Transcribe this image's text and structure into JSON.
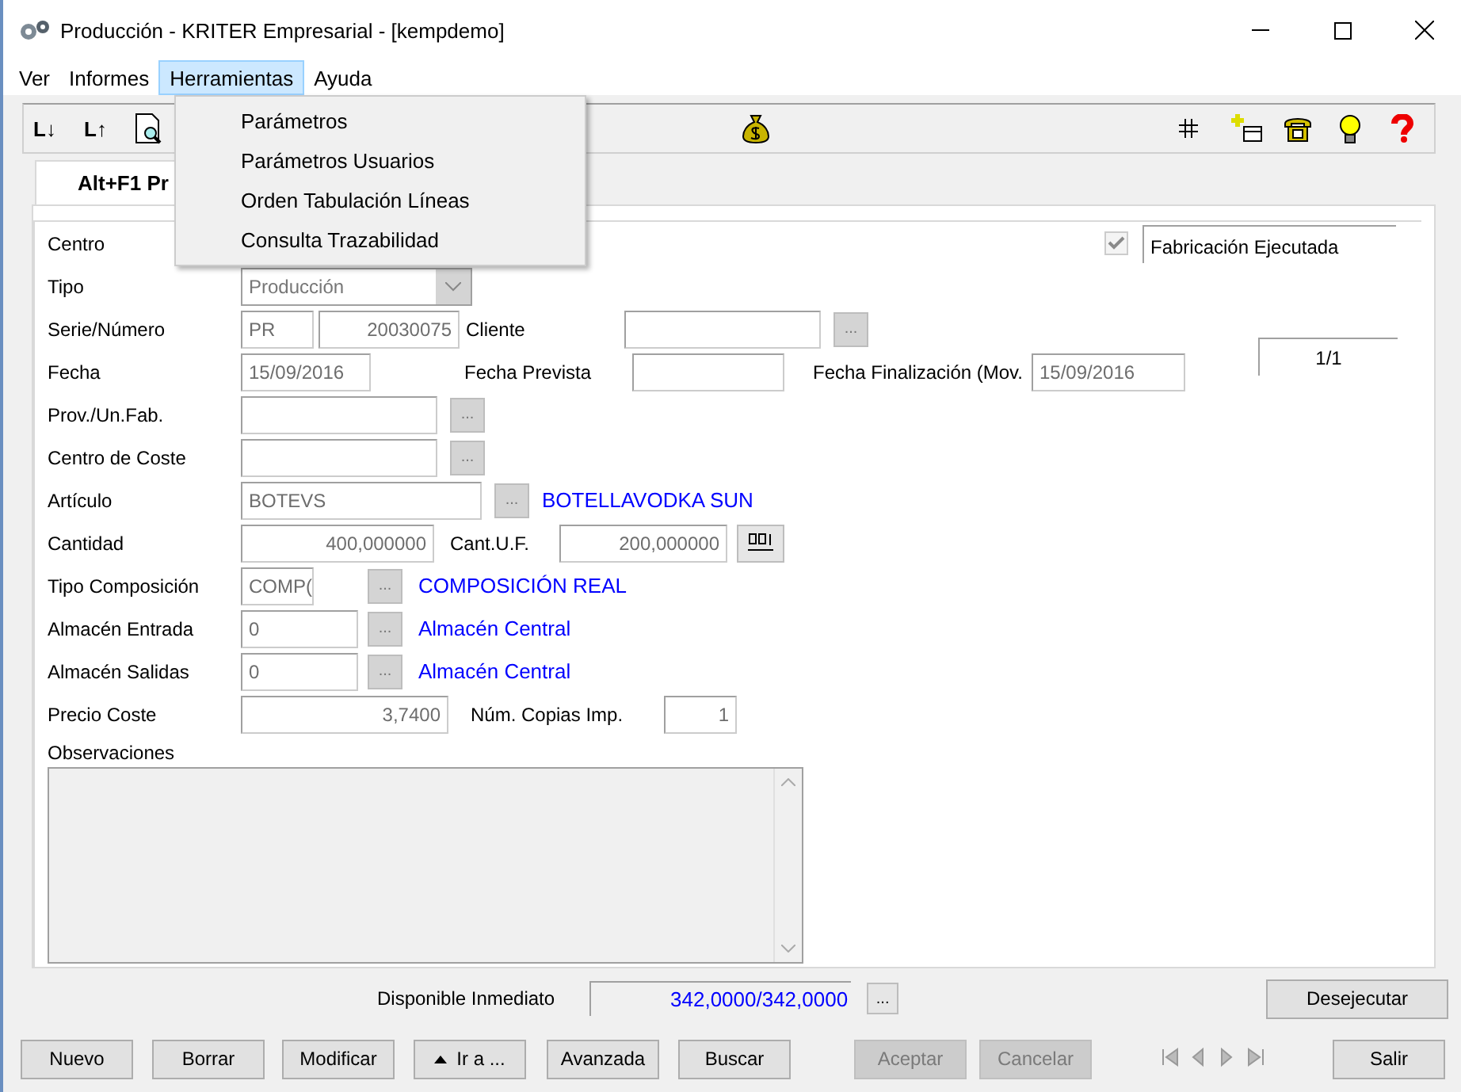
{
  "window": {
    "title": "Producción - KRITER Empresarial  - [kempdemo]"
  },
  "menu": [
    {
      "label": "Ver",
      "selected": false
    },
    {
      "label": "Informes",
      "selected": false
    },
    {
      "label": "Herramientas",
      "selected": true
    },
    {
      "label": "Ayuda",
      "selected": false
    }
  ],
  "dropdown": [
    "Parámetros",
    "Parámetros Usuarios",
    "Orden Tabulación Líneas",
    "Consulta Trazabilidad"
  ],
  "toolbar": {
    "left": [
      "L↓",
      "L↑"
    ]
  },
  "tab": {
    "label": "Alt+F1 Pr",
    "selected": true
  },
  "form": {
    "centro": {
      "label": "Centro"
    },
    "fabricacion": {
      "label": "Fabricación Ejecutada",
      "checked": true,
      "disabled": true
    },
    "tipo": {
      "label": "Tipo",
      "value": "Producción"
    },
    "serie": {
      "label": "Serie/Número",
      "series": "PR",
      "number": "20030075"
    },
    "cliente": {
      "label": "Cliente",
      "lookup": "..."
    },
    "fecha": {
      "label": "Fecha",
      "value": "15/09/2016"
    },
    "fecha_prevista": {
      "label": "Fecha Prevista"
    },
    "fecha_fin": {
      "label": "Fecha Finalización (Mov.",
      "value": "15/09/2016"
    },
    "record": "1/1",
    "prov": {
      "label": "Prov./Un.Fab.",
      "lookup": "..."
    },
    "centro_coste": {
      "label": "Centro de Coste",
      "lookup": "..."
    },
    "articulo": {
      "label": "Artículo",
      "value": "BOTEVS",
      "lookup": "...",
      "description": "BOTELLAVODKA SUN"
    },
    "cantidad": {
      "label": "Cantidad",
      "value": "400,000000"
    },
    "cant_uf": {
      "label": "Cant.U.F.",
      "value": "200,000000"
    },
    "tipo_composicion": {
      "label": "Tipo Composición",
      "value": "COMP(",
      "lookup": "...",
      "description": "COMPOSICIÓN REAL"
    },
    "almacen_entrada": {
      "label": "Almacén Entrada",
      "value": "0",
      "lookup": "...",
      "description": "Almacén Central"
    },
    "almacen_salidas": {
      "label": "Almacén Salidas",
      "value": "0",
      "lookup": "...",
      "description": "Almacén Central"
    },
    "precio": {
      "label": "Precio Coste",
      "value": "3,7400"
    },
    "copias": {
      "label": "Núm. Copias Imp.",
      "value": "1"
    },
    "observaciones": {
      "label": "Observaciones"
    }
  },
  "disponible": {
    "label": "Disponible Inmediato",
    "value": "342,0000/342,0000",
    "lookup": "..."
  },
  "desejecutar": {
    "label": "Desejecutar",
    "disabled": false
  },
  "buttons": [
    {
      "label": "Nuevo",
      "kind": "text",
      "disabled": false
    },
    {
      "label": "Borrar",
      "kind": "text",
      "disabled": false
    },
    {
      "label": "Modificar",
      "kind": "text",
      "disabled": false
    },
    {
      "label": "Ir a ...",
      "kind": "goto",
      "disabled": false
    },
    {
      "label": "Avanzada",
      "kind": "text",
      "disabled": false
    },
    {
      "label": "Buscar",
      "kind": "text",
      "disabled": false
    },
    {
      "label": "Aceptar",
      "kind": "text",
      "disabled": true
    },
    {
      "label": "Cancelar",
      "kind": "text",
      "disabled": true
    },
    {
      "kind": "nav",
      "disabled": true
    },
    {
      "label": "Salir",
      "kind": "text",
      "disabled": false
    }
  ]
}
